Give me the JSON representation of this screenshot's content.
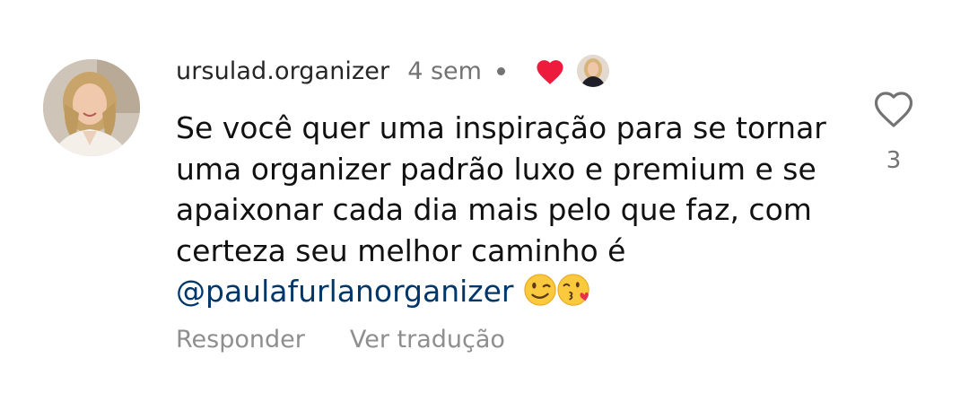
{
  "comment": {
    "username": "ursulad.organizer",
    "time": "4 sem",
    "text_before_mention": "Se você quer uma inspiração para se tornar uma organizer padrão luxo e premium e se apaixonar cada dia mais pelo que faz, com certeza seu melhor caminho é ",
    "mention": "@paulafurlanorganizer",
    "emojis": [
      "winking-face",
      "face-blowing-kiss"
    ],
    "liked_by_author_icon": "heart-filled-red",
    "actions": {
      "reply": "Responder",
      "translate": "Ver tradução"
    },
    "like": {
      "icon": "heart-outline-icon",
      "count": "3"
    }
  },
  "colors": {
    "mention": "#00376b",
    "heart_red": "#ed1c3c",
    "secondary_text": "#737373"
  }
}
